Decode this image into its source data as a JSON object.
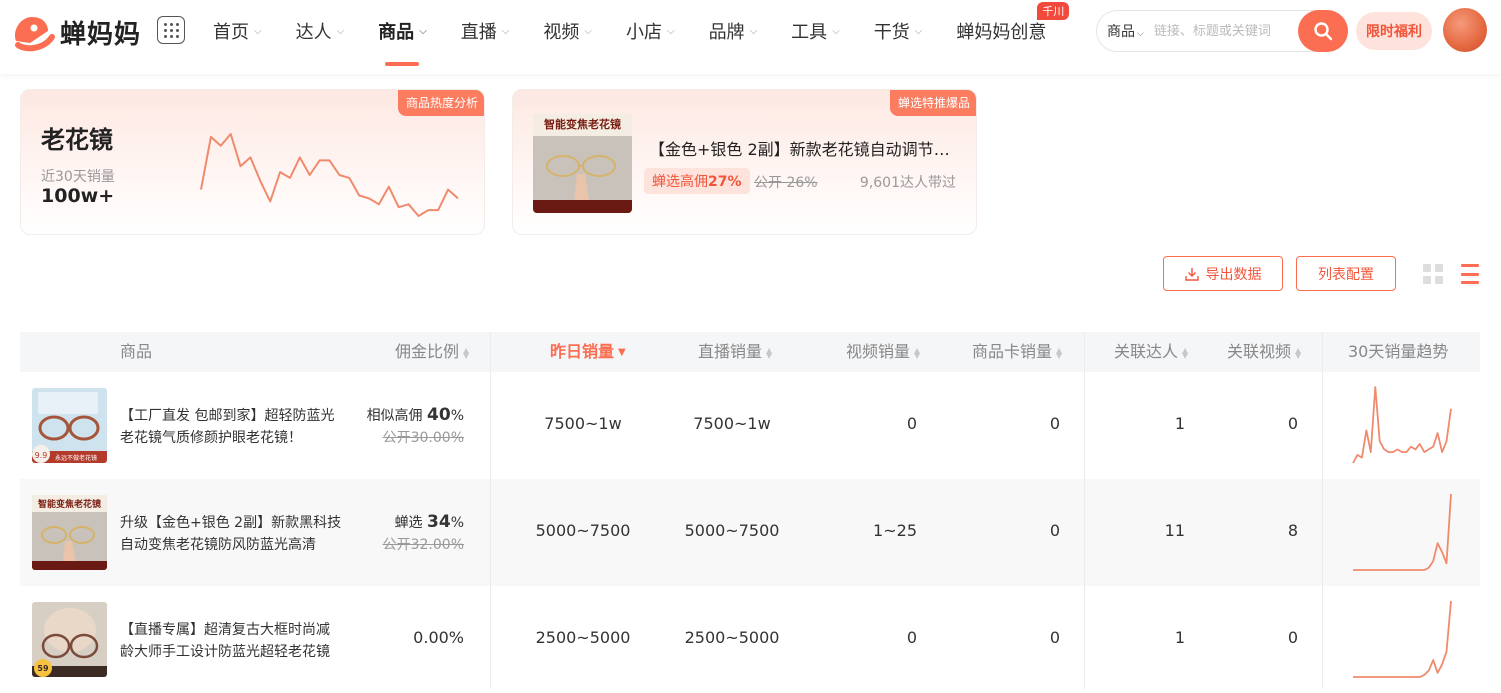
{
  "brand": {
    "name": "蝉妈妈"
  },
  "nav": [
    {
      "label": "首页",
      "chevron": true
    },
    {
      "label": "达人",
      "chevron": true
    },
    {
      "label": "商品",
      "chevron": true,
      "active": true
    },
    {
      "label": "直播",
      "chevron": true
    },
    {
      "label": "视频",
      "chevron": true
    },
    {
      "label": "小店",
      "chevron": true
    },
    {
      "label": "品牌",
      "chevron": true
    },
    {
      "label": "工具",
      "chevron": true
    },
    {
      "label": "干货",
      "chevron": true
    },
    {
      "label": "蝉妈妈创意",
      "chevron": false,
      "badge": "千川"
    }
  ],
  "search": {
    "category": "商品",
    "placeholder": "链接、标题或关键词"
  },
  "promo": "限时福利",
  "card_keyword": {
    "tag": "商品热度分析",
    "keyword": "老花镜",
    "sub_label": "近30天销量",
    "value": "100w+",
    "trend": [
      62,
      80,
      77,
      81,
      70,
      73,
      65,
      58,
      68,
      66,
      73,
      67,
      72,
      72,
      67,
      66,
      60,
      59,
      57,
      63,
      56,
      57,
      53,
      55,
      55,
      62,
      59
    ]
  },
  "card_product": {
    "tag": "蝉选特推爆品",
    "title": "【金色+银色 2副】新款老花镜自动调节度数高清防蓝光",
    "chip_prefix": "蝉选高佣",
    "chip_value": "27%",
    "public_rate": "公开 26%",
    "daren": "9,601达人带过",
    "image_text": "智能变焦老花镜"
  },
  "toolbar": {
    "export": "导出数据",
    "config": "列表配置"
  },
  "columns": [
    {
      "label": "商品",
      "sortable": false
    },
    {
      "label": "佣金比例",
      "sortable": true
    },
    {
      "label": "昨日销量",
      "sortable": true,
      "active": true
    },
    {
      "label": "直播销量",
      "sortable": true
    },
    {
      "label": "视频销量",
      "sortable": true
    },
    {
      "label": "商品卡销量",
      "sortable": true
    },
    {
      "label": "关联达人",
      "sortable": true
    },
    {
      "label": "关联视频",
      "sortable": true
    },
    {
      "label": "30天销量趋势",
      "sortable": false
    }
  ],
  "rows": [
    {
      "title": "【工厂直发 包邮到家】超轻防蓝光老花镜气质修颜护眼老花镜！",
      "commission_prefix": "相似高佣",
      "commission_value": "40",
      "commission_unit": "%",
      "commission_public": "公开30.00%",
      "yesterday": "7500~1w",
      "live": "7500~1w",
      "video": "0",
      "card": "0",
      "daren": "1",
      "videos": "0",
      "thumb_price": "9.9",
      "thumb_caption": "永远不做老花镜",
      "trend": [
        2,
        5,
        4,
        14,
        6,
        30,
        10,
        7,
        6,
        6,
        7,
        6,
        6,
        8,
        7,
        9,
        6,
        7,
        8,
        13,
        6,
        10,
        22
      ]
    },
    {
      "title": "升级【金色+银色 2副】新款黑科技自动变焦老花镜防风防蓝光高清",
      "commission_prefix": "蝉选",
      "commission_value": "34",
      "commission_unit": "%",
      "commission_public": "公开32.00%",
      "yesterday": "5000~7500",
      "live": "5000~7500",
      "video": "1~25",
      "card": "0",
      "daren": "11",
      "videos": "8",
      "thumb_text": "智能变焦老花镜",
      "trend": [
        0,
        0,
        0,
        0,
        0,
        0,
        0,
        0,
        0,
        0,
        0,
        0,
        0,
        0,
        0,
        0,
        0,
        1,
        4,
        12,
        8,
        3,
        34
      ]
    },
    {
      "title": "【直播专属】超清复古大框时尚减龄大师手工设计防蓝光超轻老花镜",
      "commission_single": "0.00%",
      "yesterday": "2500~5000",
      "live": "2500~5000",
      "video": "0",
      "card": "0",
      "daren": "1",
      "videos": "0",
      "thumb_price": "59",
      "trend": [
        0,
        0,
        0,
        0,
        0,
        0,
        0,
        0,
        0,
        0,
        0,
        0,
        0,
        0,
        0,
        0,
        1,
        3,
        8,
        2,
        6,
        12,
        36
      ]
    }
  ]
}
